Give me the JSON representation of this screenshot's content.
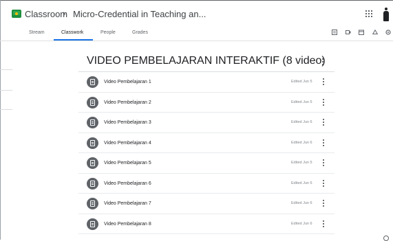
{
  "header": {
    "app_title": "Classroom",
    "separator": "›",
    "course_title": "Micro-Credential in Teaching an..."
  },
  "tabs": [
    {
      "label": "Stream",
      "active": false
    },
    {
      "label": "Classwork",
      "active": true
    },
    {
      "label": "People",
      "active": false
    },
    {
      "label": "Grades",
      "active": false
    }
  ],
  "toolbar_icons": [
    "forms-icon",
    "meet-icon",
    "calendar-icon",
    "drive-icon",
    "settings-icon"
  ],
  "section": {
    "title": "VIDEO PEMBELAJARAN INTERAKTIF (8 video)"
  },
  "items": [
    {
      "title": "Video Pembelajaran 1",
      "meta": "Edited Jun 5"
    },
    {
      "title": "Video Pembelajaran 2",
      "meta": "Edited Jun 5"
    },
    {
      "title": "Video Pembelajaran 3",
      "meta": "Edited Jun 6"
    },
    {
      "title": "Video Pembelajaran 4",
      "meta": "Edited Jun 6"
    },
    {
      "title": "Video Pembelajaran 5",
      "meta": "Edited Jun 5"
    },
    {
      "title": "Video Pembelajaran 6",
      "meta": "Edited Jun 5"
    },
    {
      "title": "Video Pembelajaran 7",
      "meta": "Edited Jun 6"
    },
    {
      "title": "Video Pembelajaran 8",
      "meta": "Edited Jun 6"
    }
  ],
  "colors": {
    "accent": "#1a73e8",
    "logo_green": "#1e8e3e",
    "icon_circle": "#5f6368"
  }
}
